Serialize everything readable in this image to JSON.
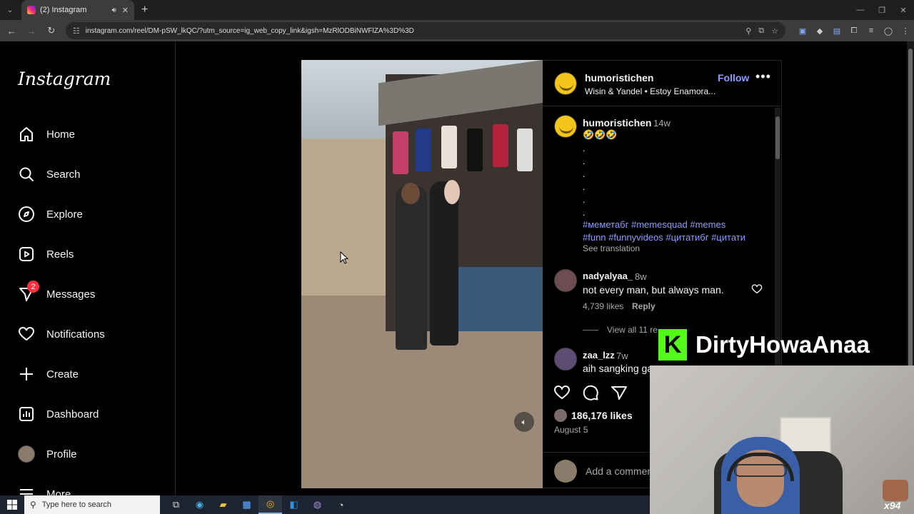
{
  "browser": {
    "tab_title": "(2) Instagram",
    "url": "instagram.com/reel/DM-pSW_lkQC/?utm_source=ig_web_copy_link&igsh=MzRlODBiNWFlZA%3D%3D"
  },
  "sidebar": {
    "logo": "Instagram",
    "items": [
      {
        "label": "Home",
        "icon": "home-icon"
      },
      {
        "label": "Search",
        "icon": "search-icon"
      },
      {
        "label": "Explore",
        "icon": "compass-icon"
      },
      {
        "label": "Reels",
        "icon": "reels-icon"
      },
      {
        "label": "Messages",
        "icon": "messenger-icon",
        "badge": "2"
      },
      {
        "label": "Notifications",
        "icon": "heart-icon"
      },
      {
        "label": "Create",
        "icon": "plus-icon"
      },
      {
        "label": "Dashboard",
        "icon": "dashboard-icon"
      },
      {
        "label": "Profile",
        "icon": "profile-avatar"
      },
      {
        "label": "More",
        "icon": "menu-icon"
      }
    ]
  },
  "post": {
    "username": "humoristichen",
    "follow_label": "Follow",
    "music": "Wisin & Yandel • Estoy Enamora...",
    "caption": {
      "username": "humoristichen",
      "time": "14w",
      "emojis": "🤣🤣🤣",
      "dots": [
        ".",
        ".",
        ".",
        ".",
        ".",
        "."
      ],
      "tags_line1": "#меметабг #memesquad #memes",
      "tags_line2": "#funn #funnyvideos #цитатибг #цитати",
      "see_translation": "See translation"
    },
    "comments": [
      {
        "username": "nadyalyaa_",
        "time": "8w",
        "text": "not every man, but always man.",
        "likes": "4,739 likes",
        "reply": "Reply",
        "view_replies": "View all 11 re"
      },
      {
        "username": "zaa_lzz",
        "time": "7w",
        "text": "aih sangking ga"
      }
    ],
    "likes": "186,176 likes",
    "date": "August 5",
    "add_comment_placeholder": "Add a commen"
  },
  "overlay": {
    "kick_letter": "K",
    "streamer_name": "DirtyHowaAnaa",
    "emote_count": "x94"
  },
  "taskbar": {
    "search_placeholder": "Type here to search"
  }
}
